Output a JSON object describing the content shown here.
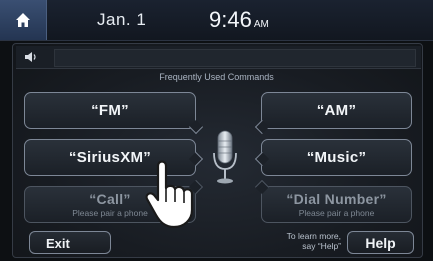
{
  "status": {
    "date": "Jan.  1",
    "time": "9:46",
    "ampm": "AM"
  },
  "voice": {
    "header": "Frequently Used Commands"
  },
  "commands": [
    {
      "label": "“FM”"
    },
    {
      "label": "“AM”"
    },
    {
      "label": "“SiriusXM”"
    },
    {
      "label": "“Music”"
    },
    {
      "label": "“Call”",
      "sub": "Please pair a phone"
    },
    {
      "label": "“Dial Number”",
      "sub": "Please pair a phone"
    }
  ],
  "footer": {
    "exit_label": "Exit",
    "learn_line1": "To learn more,",
    "learn_line2": "say “Help”",
    "help_label": "Help"
  },
  "colors": {
    "home_button": "#2f4466",
    "accent_border": "#7d8796",
    "mic": "#c9d0d8"
  },
  "icons": [
    "home-icon",
    "speaker-icon",
    "microphone-icon",
    "hand-pointer-icon"
  ]
}
